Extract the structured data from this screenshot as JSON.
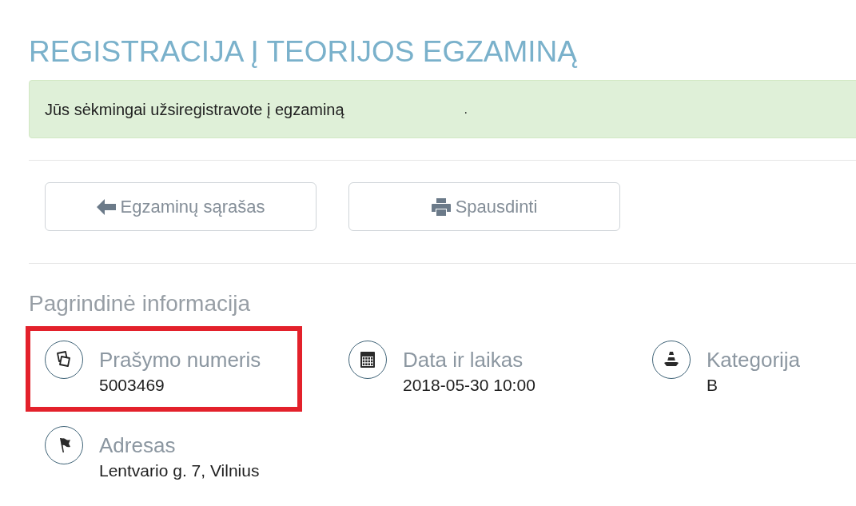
{
  "page": {
    "title": "REGISTRACIJA Į TEORIJOS EGZAMINĄ"
  },
  "alert": {
    "kind": "success",
    "message": "Jūs sėkmingai užsiregistravote į egzaminą",
    "trailing": "."
  },
  "buttons": [
    {
      "kind": "back",
      "label": "Egzaminų sąrašas"
    },
    {
      "kind": "print",
      "label": "Spausdinti"
    }
  ],
  "section": {
    "title": "Pagrindinė informacija",
    "items": [
      {
        "kind": "documents",
        "label": "Prašymo numeris",
        "value": "5003469",
        "highlighted": true
      },
      {
        "kind": "calendar",
        "label": "Data ir laikas",
        "value": "2018-05-30 10:00",
        "highlighted": false
      },
      {
        "kind": "cone",
        "label": "Kategorija",
        "value": "B",
        "highlighted": false
      },
      {
        "kind": "flag",
        "label": "Adresas",
        "value": "Lentvario g. 7, Vilnius",
        "highlighted": false
      }
    ]
  }
}
